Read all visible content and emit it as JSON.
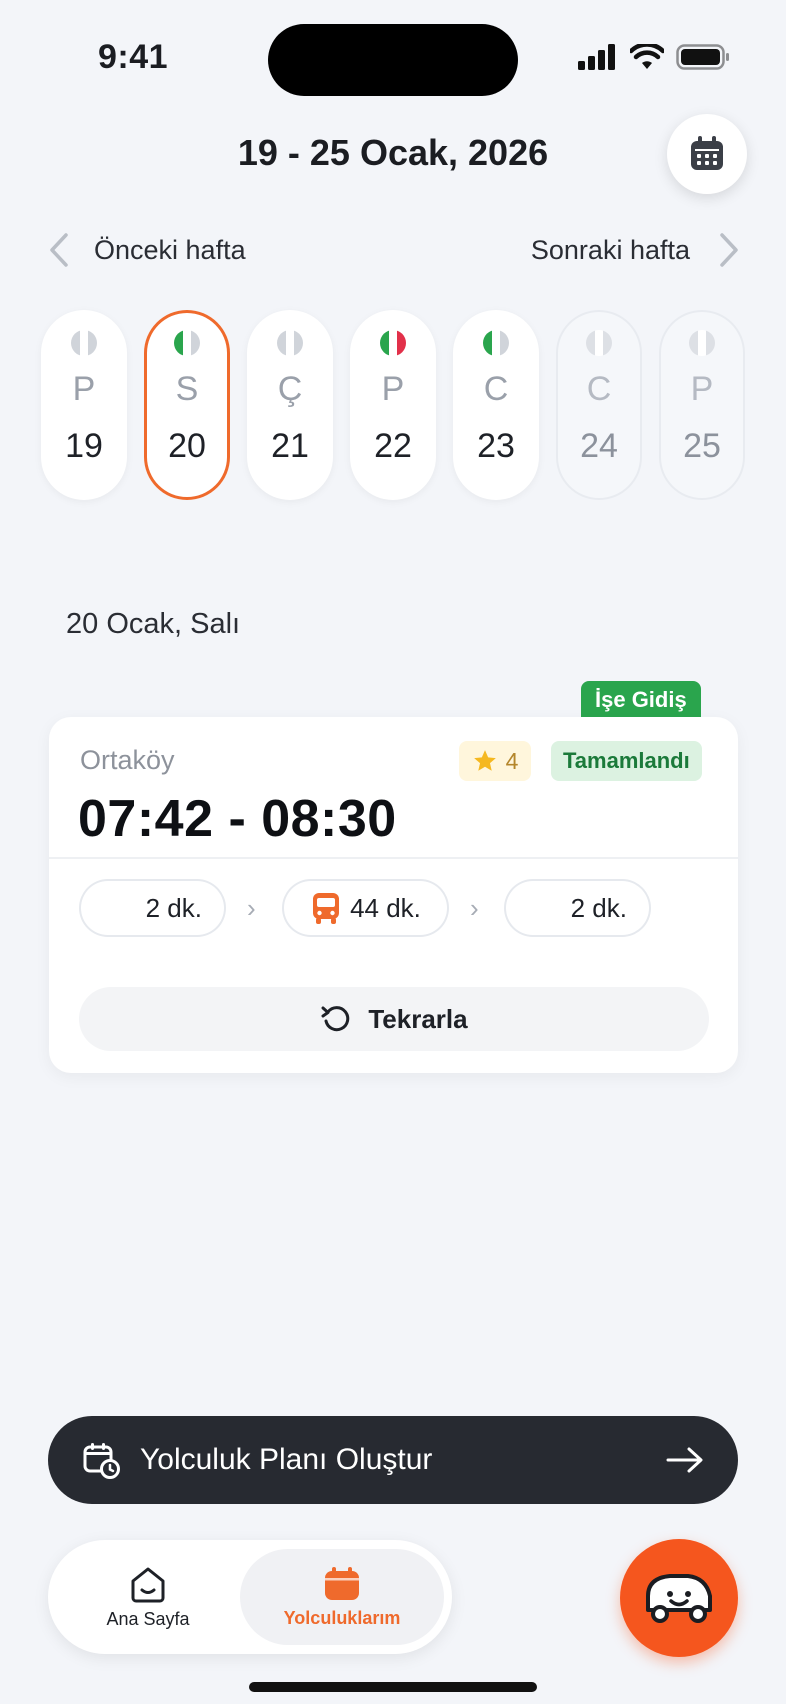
{
  "status_bar": {
    "time": "9:41"
  },
  "header": {
    "week_range": "19 - 25 Ocak, 2026"
  },
  "week_nav": {
    "prev_label": "Önceki hafta",
    "next_label": "Sonraki hafta"
  },
  "days": [
    {
      "letter": "P",
      "number": "19",
      "flag": "gray"
    },
    {
      "letter": "S",
      "number": "20",
      "flag": "green",
      "selected": true
    },
    {
      "letter": "Ç",
      "number": "21",
      "flag": "gray"
    },
    {
      "letter": "P",
      "number": "22",
      "flag": "red"
    },
    {
      "letter": "C",
      "number": "23",
      "flag": "green"
    },
    {
      "letter": "C",
      "number": "24",
      "flag": "gray",
      "future": true
    },
    {
      "letter": "P",
      "number": "25",
      "flag": "gray",
      "future": true
    }
  ],
  "selected_date_label": "20 Ocak, Salı",
  "trip": {
    "tag": "İşe Gidiş",
    "origin": "Ortaköy",
    "time_range": "07:42 - 08:30",
    "rating": "4",
    "status": "Tamamlandı",
    "legs": [
      {
        "duration": "2 dk.",
        "mode": "walk"
      },
      {
        "duration": "44 dk.",
        "mode": "bus"
      },
      {
        "duration": "2 dk.",
        "mode": "walk"
      }
    ],
    "repeat_label": "Tekrarla"
  },
  "cta": {
    "label": "Yolculuk Planı Oluştur"
  },
  "tabbar": {
    "home_label": "Ana Sayfa",
    "trips_label": "Yolculuklarım"
  },
  "colors": {
    "accent": "#ef6a2c",
    "success": "#2aa54d",
    "dark": "#272a31"
  }
}
